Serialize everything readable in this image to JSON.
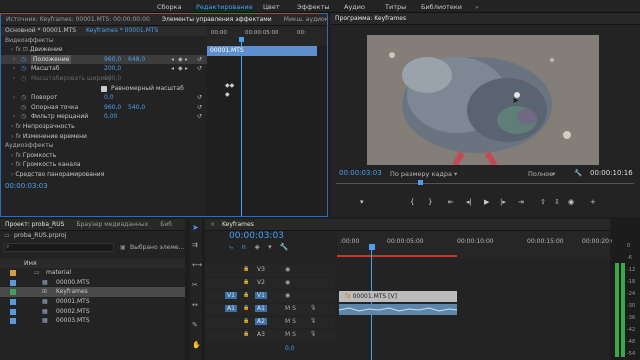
{
  "topbar": {
    "items": [
      "Сборка",
      "Редактирование",
      "Цвет",
      "Эффекты",
      "Аудио",
      "Титры",
      "Библиотеки"
    ],
    "active_index": 1
  },
  "effect_controls": {
    "tabs": [
      "Источник: Keyframes: 00001.MTS: 00:00:00:00",
      "Элементы управления эффектами",
      "Микш. аудиоклипа: Keyframes"
    ],
    "active_tab": 1,
    "master": "Основной * 00001.MTS",
    "sequence": "Keyframes * 00001.MTS",
    "ruler_times": [
      "00:00",
      "00:00:05:00",
      "00:"
    ],
    "clip_label": "00001.MTS",
    "video_effects": "Видеоэффекты",
    "motion": "Движение",
    "position": {
      "label": "Положение",
      "x": "960,0",
      "y": "648,0"
    },
    "scale": {
      "label": "Масштаб",
      "value": "200,0"
    },
    "scale_width": "Масштабировать ширину",
    "scale_width_value": "100,0",
    "uniform_scale": "Равномерный масштаб",
    "rotation": {
      "label": "Поворот",
      "value": "0,0"
    },
    "anchor": {
      "label": "Опорная точка",
      "x": "960,0",
      "y": "540,0"
    },
    "flicker": {
      "label": "Фильтр мерцаний",
      "value": "0,00"
    },
    "opacity": "Непрозрачность",
    "time_remap": "Изменение времени",
    "audio_effects": "Аудиоэффекты",
    "volume": "Громкость",
    "channel_volume": "Громкость канала",
    "panner": "Средство панорамирования",
    "timecode": "00:00:03:03"
  },
  "program": {
    "title": "Программа: Keyframes",
    "timecode": "00:00:03:03",
    "fit": "По размеру кадра",
    "quality": "Полное",
    "duration": "00:00:10:16"
  },
  "project": {
    "tabs": [
      "Проект: proba_RUS",
      "Браузер медиаданных",
      "Биб"
    ],
    "file": "proba_RUS.prproj",
    "selected": "Выбрано элеме...",
    "name_header": "Имя",
    "items": [
      {
        "name": "material",
        "color": "#d89a3e",
        "type": "folder"
      },
      {
        "name": "00000.MTS",
        "color": "#5a9ad8",
        "type": "clip"
      },
      {
        "name": "Keyframes",
        "color": "#3fa15a",
        "type": "sequence"
      },
      {
        "name": "00001.MTS",
        "color": "#5a9ad8",
        "type": "clip"
      },
      {
        "name": "00002.MTS",
        "color": "#5a9ad8",
        "type": "clip"
      },
      {
        "name": "00003.MTS",
        "color": "#5a9ad8",
        "type": "clip"
      }
    ]
  },
  "timeline": {
    "title": "Keyframes",
    "timecode": "00:00:03:03",
    "ruler": [
      ":00:00",
      "00:00:05:00",
      "00:00:10:00",
      "00:00:15:00",
      "00:00:20:00"
    ],
    "tracks": [
      {
        "name": "V3",
        "target": ""
      },
      {
        "name": "V2",
        "target": ""
      },
      {
        "name": "V1",
        "target": "V1"
      },
      {
        "name": "A1",
        "target": "A1"
      },
      {
        "name": "A2",
        "target": ""
      },
      {
        "name": "A3",
        "target": ""
      }
    ],
    "clip_label": "00001.MTS [V]",
    "master_value": "0,0"
  },
  "meter": {
    "labels": [
      "0",
      "-6",
      "-12",
      "-18",
      "-24",
      "-30",
      "-36",
      "-42",
      "-48",
      "-54"
    ]
  }
}
